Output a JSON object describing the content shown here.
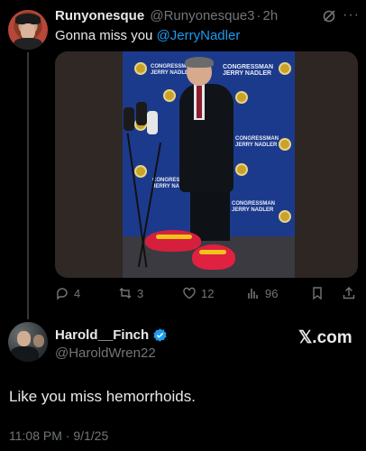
{
  "tweet1": {
    "display_name": "Runyonesque",
    "handle": "@Runyonesque3",
    "separator": "·",
    "time": "2h",
    "text": "Gonna miss you ",
    "mention": "@JerryNadler",
    "media": {
      "backdrop_text_1": "CONGRESSMAN",
      "backdrop_text_2": "JERRY NADLER",
      "backdrop_color": "#1c3a8c",
      "shoe_color": "#e0213f"
    },
    "actions": {
      "replies": "4",
      "reposts": "3",
      "likes": "12",
      "views": "96"
    }
  },
  "tweet2": {
    "display_name": "Harold__Finch",
    "handle": "@HaroldWren22",
    "brand": "𝕏.com",
    "text": "Like you miss hemorrhoids.",
    "timestamp": "11:08 PM · 9/1/25"
  },
  "colors": {
    "background": "#000000",
    "text": "#e7e9ea",
    "muted": "#71767b",
    "accent": "#1d9bf0"
  },
  "icons": [
    "grok-icon",
    "more-icon",
    "reply-icon",
    "repost-icon",
    "like-icon",
    "views-icon",
    "bookmark-icon",
    "share-icon",
    "verified-icon"
  ]
}
